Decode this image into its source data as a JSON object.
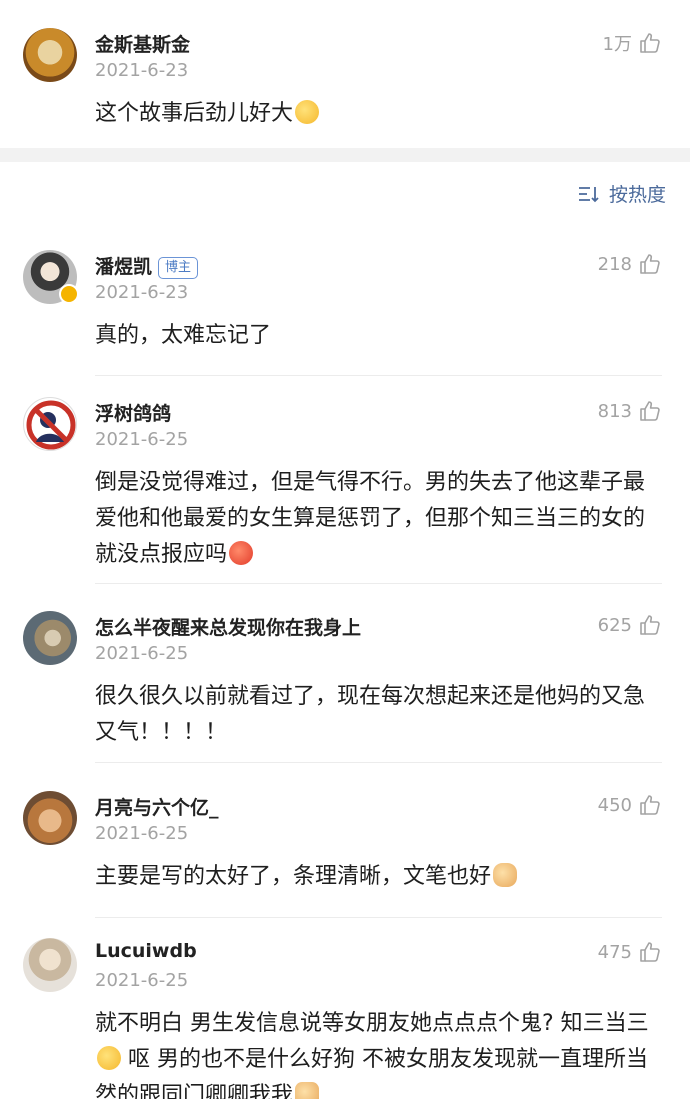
{
  "top_comment": {
    "username": "金斯基斯金",
    "date": "2021-6-23",
    "likes": "1万",
    "text": "这个故事后劲儿好大"
  },
  "sort": {
    "label": "按热度"
  },
  "comments": [
    {
      "username": "潘煜凯",
      "badge": "博主",
      "date": "2021-6-23",
      "likes": "218",
      "text": "真的，太难忘记了"
    },
    {
      "username": "浮树鸽鸽",
      "date": "2021-6-25",
      "likes": "813",
      "text": "倒是没觉得难过，但是气得不行。男的失去了他这辈子最爱他和他最爱的女生算是惩罚了，但那个知三当三的女的就没点报应吗"
    },
    {
      "username": "怎么半夜醒来总发现你在我身上",
      "date": "2021-6-25",
      "likes": "625",
      "text": "很久很久以前就看过了，现在每次想起来还是他妈的又急又气！！！！"
    },
    {
      "username": "月亮与六个亿_",
      "date": "2021-6-25",
      "likes": "450",
      "text": "主要是写的太好了，条理清晰，文笔也好"
    },
    {
      "username": "Lucuiwdb",
      "date": "2021-6-25",
      "likes": "475",
      "text_part1": "就不明白 男生发信息说等女朋友她点点点个鬼? 知三当三",
      "text_part2": " 呕 男的也不是什么好狗 不被女朋友发现就一直理所当然的跟同门卿卿我我"
    }
  ],
  "colors": {
    "date": "#a3a3a3",
    "sort": "#4b6a9b",
    "badge": "#4d7cc4",
    "separator": "#f2f2f2"
  }
}
